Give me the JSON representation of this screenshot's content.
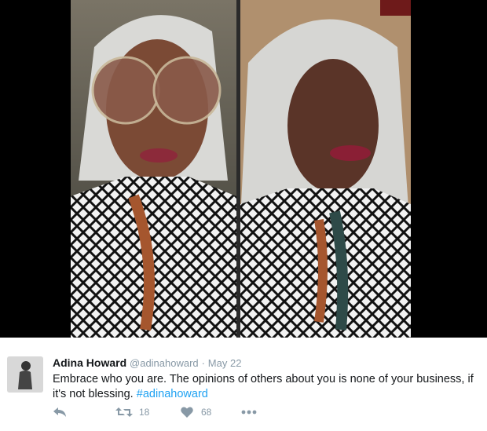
{
  "tweet": {
    "name": "Adina Howard",
    "handle": "@adinahoward",
    "separator": "·",
    "date": "May 22",
    "text": "Embrace who you are. The opinions of others about you is none of your business, if it's not blessing.",
    "hashtag": "#adinahoward",
    "retweet_count": "18",
    "like_count": "68"
  },
  "icons": {
    "reply": "reply-icon",
    "retweet": "retweet-icon",
    "like": "heart-icon",
    "more": "more-icon"
  },
  "colors": {
    "link": "#1da1f2",
    "muted": "#8899a6",
    "text": "#14171a"
  }
}
